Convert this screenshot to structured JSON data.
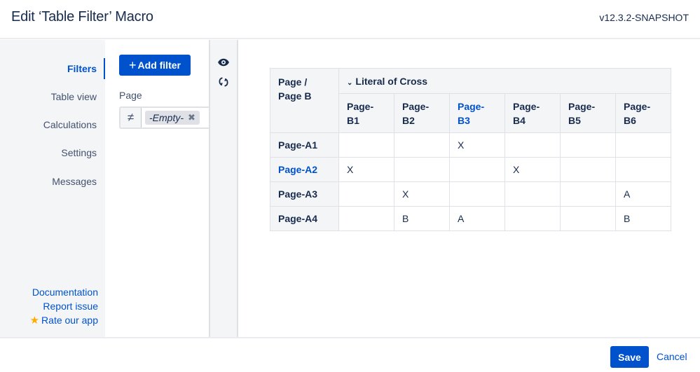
{
  "header": {
    "title": "Edit ‘Table Filter’ Macro",
    "version": "v12.3.2-SNAPSHOT"
  },
  "sidebar": {
    "items": [
      {
        "label": "Filters",
        "active": true
      },
      {
        "label": "Table view",
        "active": false
      },
      {
        "label": "Calculations",
        "active": false
      },
      {
        "label": "Settings",
        "active": false
      },
      {
        "label": "Messages",
        "active": false
      }
    ],
    "links": {
      "documentation": "Documentation",
      "report_issue": "Report issue",
      "rate_app": "Rate our app"
    }
  },
  "filters": {
    "add_filter_label": "Add filter",
    "filter_name": "Page",
    "operator": "≠",
    "tag_value": "-Empty-",
    "tag_remove": "✖"
  },
  "toolbar": {
    "icons": [
      "eye-icon",
      "refresh-icon"
    ]
  },
  "table": {
    "corner_line1": "Page /",
    "corner_line2": "Page B",
    "group_label": "Literal of Cross",
    "columns": [
      {
        "line1": "Page-",
        "line2": "B1",
        "highlight": false
      },
      {
        "line1": "Page-",
        "line2": "B2",
        "highlight": false
      },
      {
        "line1": "Page-",
        "line2": "B3",
        "highlight": true
      },
      {
        "line1": "Page-",
        "line2": "B4",
        "highlight": false
      },
      {
        "line1": "Page-",
        "line2": "B5",
        "highlight": false
      },
      {
        "line1": "Page-",
        "line2": "B6",
        "highlight": false
      }
    ],
    "rows": [
      {
        "label": "Page-A1",
        "highlight": false,
        "cells": [
          "",
          "",
          "X",
          "",
          "",
          ""
        ]
      },
      {
        "label": "Page-A2",
        "highlight": true,
        "cells": [
          "X",
          "",
          "",
          "X",
          "",
          ""
        ]
      },
      {
        "label": "Page-A3",
        "highlight": false,
        "cells": [
          "",
          "X",
          "",
          "",
          "",
          "A"
        ]
      },
      {
        "label": "Page-A4",
        "highlight": false,
        "cells": [
          "",
          "B",
          "A",
          "",
          "",
          "B"
        ]
      }
    ]
  },
  "footer": {
    "save_label": "Save",
    "cancel_label": "Cancel"
  },
  "colors": {
    "accent": "#0052cc",
    "text": "#172b4d",
    "sidebar_bg": "#f4f5f7",
    "star": "#ffab00"
  }
}
